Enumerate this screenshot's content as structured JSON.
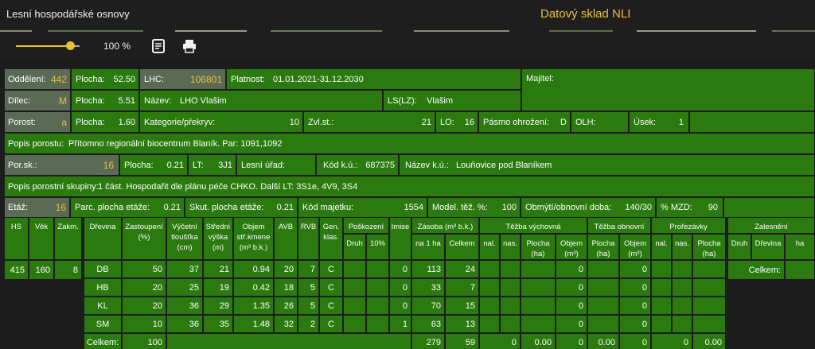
{
  "app": {
    "title": "Lesní hospodářské osnovy",
    "right_title": "Datový sklad NLI"
  },
  "toolbar": {
    "zoom": "100 %",
    "zoom_fraction": 0.85,
    "icons": [
      "notes-icon",
      "print-icon"
    ]
  },
  "form": {
    "oddeleni_label": "Oddělení:",
    "oddeleni": "442",
    "plocha_label": "Plocha:",
    "plocha1": "52.50",
    "lhc_label": "LHC:",
    "lhc": "106801",
    "platnost_label": "Platnost:",
    "platnost": "01.01.2021-31.12.2030",
    "majitel_label": "Majitel:",
    "dilec_label": "Dílec:",
    "dilec": "M",
    "plocha2": "5.51",
    "nazev_label": "Název:",
    "nazev": "LHO Vlašim",
    "lslz_label": "LS(LZ):",
    "lslz": "Vlašim",
    "porost_label": "Porost:",
    "porost": "a",
    "plocha3": "1.60",
    "kategorie_label": "Kategorie/překryv:",
    "kategorie": "10",
    "zvlst_label": "Zvl.st.:",
    "zvlst": "21",
    "lo_label": "LO:",
    "lo": "16",
    "pasmo_label": "Pásmo ohrožení:",
    "pasmo": "D",
    "olh_label": "OLH:",
    "usek_label": "Úsek:",
    "usek": "1",
    "popis_porostu_label": "Popis porostu:",
    "popis_porostu": "Přítomno regionální biocentrum Blaník. Par: 1091,1092",
    "porsk_label": "Por.sk.:",
    "porsk": "16",
    "plocha4": "0.21",
    "lt_label": "LT:",
    "lt": "3J1",
    "lesni_urad_label": "Lesní úřad:",
    "kodku_label": "Kód k.ú.:",
    "kodku": "687375",
    "nazevku_label": "Název k.ú.:",
    "nazevku": "Louňovice pod Blaníkem",
    "popis_skupiny_label": "Popis porostní skupiny:",
    "popis_skupiny": "1 část. Hospodařit dle plánu péče CHKO. Další LT: 3S1e, 4V9, 3S4",
    "etaz_label": "Etáž:",
    "etaz": "16",
    "parc_label": "Parc. plocha etáže:",
    "parc": "0.21",
    "skut_label": "Skut. plocha etáže:",
    "skut": "0.21",
    "kod_majetku_label": "Kód majetku:",
    "kod_majetku": "1554",
    "model_label": "Model. těž. %:",
    "model": "100",
    "obmyti_label": "Obmýtí/obnovní doba:",
    "obmyti": "140/30",
    "mzd_label": "% MZD:",
    "mzd": "90"
  },
  "table": {
    "h": {
      "hs": "HS",
      "vek": "Věk",
      "zakm": "Zakm.",
      "dreviny": "Dřevina",
      "zast": "Zastoupení",
      "zast2": "(%)",
      "vyc": "Výčetní",
      "vyc2": "tloušťka",
      "vyc3": "(cm)",
      "str": "Střední",
      "str2": "výška",
      "str3": "(m)",
      "obj": "Objem",
      "obj2": "stř.kmene",
      "obj3": "(m³ b.k.)",
      "avb": "AVB",
      "rvb": "RVB",
      "gen": "Gen.",
      "gen2": "klas.",
      "posk": "Poškození",
      "druh": "Druh",
      "p10": "10%",
      "imise": "Imise",
      "zasoba": "Zásoba (m³ b.k.)",
      "na1": "na 1 ha",
      "celkem": "Celkem",
      "tv": "Těžba výchovná",
      "nal": "nal.",
      "nas": "nas.",
      "plocha": "Plocha",
      "ha": "(ha)",
      "objem": "Objem",
      "m3": "(m³)",
      "to": "Těžba obnovní",
      "proj": "Prořezávky",
      "zal": "Zalesnění",
      "zdruh": "Druh",
      "zdrev": "Dřevina",
      "zha": "ha",
      "zcelkem": "Celkem:"
    },
    "left": {
      "hs": "415",
      "vek": "160",
      "zakm": "8"
    },
    "rows": [
      {
        "dr": "DB",
        "zast": "50",
        "vyc": "37",
        "str": "21",
        "obj": "0.94",
        "avb": "20",
        "rvb": "7",
        "gen": "C",
        "imise": "0",
        "na1": "113",
        "cel": "24",
        "tvobj": "0",
        "toobj": "0"
      },
      {
        "dr": "HB",
        "zast": "20",
        "vyc": "25",
        "str": "19",
        "obj": "0.42",
        "avb": "18",
        "rvb": "5",
        "gen": "C",
        "imise": "0",
        "na1": "33",
        "cel": "7",
        "tvobj": "0",
        "toobj": "0"
      },
      {
        "dr": "KL",
        "zast": "20",
        "vyc": "36",
        "str": "29",
        "obj": "1.35",
        "avb": "26",
        "rvb": "5",
        "gen": "C",
        "imise": "0",
        "na1": "70",
        "cel": "15",
        "tvobj": "0",
        "toobj": "0"
      },
      {
        "dr": "SM",
        "zast": "10",
        "vyc": "36",
        "str": "35",
        "obj": "1.48",
        "avb": "32",
        "rvb": "2",
        "gen": "C",
        "imise": "1",
        "na1": "63",
        "cel": "13",
        "tvobj": "0",
        "toobj": "0"
      }
    ],
    "total": {
      "label": "Celkem:",
      "zast": "100",
      "na1": "279",
      "cel": "59",
      "tvnal": "0",
      "tvpl": "0.00",
      "tvobj": "0",
      "topl": "0.00",
      "toobj": "0",
      "prnal": "0",
      "prpl": "0.00"
    }
  }
}
